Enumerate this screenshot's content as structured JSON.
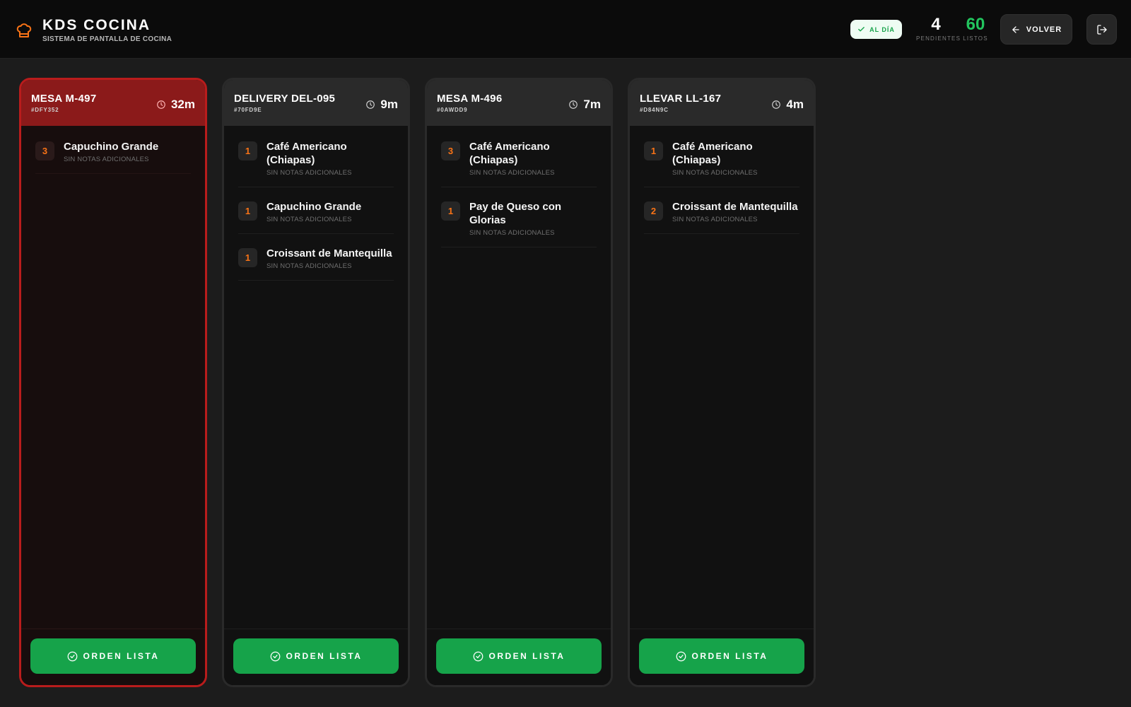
{
  "header": {
    "title": "KDS COCINA",
    "subtitle": "SISTEMA DE PANTALLA DE COCINA",
    "status_label": "AL DÍA",
    "pending_count": "4",
    "pending_label": "PENDIENTES",
    "ready_count": "60",
    "ready_label": "LISTOS",
    "back_label": "VOLVER"
  },
  "colors": {
    "accent_orange": "#f97316",
    "success_green": "#16a34a",
    "late_red": "#8b1a1a"
  },
  "orders": [
    {
      "title": "MESA M-497",
      "code": "#DFY352",
      "elapsed": "32m",
      "late": true,
      "items": [
        {
          "qty": "3",
          "name": "Capuchino Grande",
          "notes": "SIN NOTAS ADICIONALES"
        }
      ],
      "action_label": "ORDEN LISTA"
    },
    {
      "title": "DELIVERY DEL-095",
      "code": "#70FD9E",
      "elapsed": "9m",
      "late": false,
      "items": [
        {
          "qty": "1",
          "name": "Café Americano (Chiapas)",
          "notes": "SIN NOTAS ADICIONALES"
        },
        {
          "qty": "1",
          "name": "Capuchino Grande",
          "notes": "SIN NOTAS ADICIONALES"
        },
        {
          "qty": "1",
          "name": "Croissant de Mantequilla",
          "notes": "SIN NOTAS ADICIONALES"
        }
      ],
      "action_label": "ORDEN LISTA"
    },
    {
      "title": "MESA M-496",
      "code": "#0AWDD9",
      "elapsed": "7m",
      "late": false,
      "items": [
        {
          "qty": "3",
          "name": "Café Americano (Chiapas)",
          "notes": "SIN NOTAS ADICIONALES"
        },
        {
          "qty": "1",
          "name": "Pay de Queso con Glorias",
          "notes": "SIN NOTAS ADICIONALES"
        }
      ],
      "action_label": "ORDEN LISTA"
    },
    {
      "title": "LLEVAR LL-167",
      "code": "#D84N9C",
      "elapsed": "4m",
      "late": false,
      "items": [
        {
          "qty": "1",
          "name": "Café Americano (Chiapas)",
          "notes": "SIN NOTAS ADICIONALES"
        },
        {
          "qty": "2",
          "name": "Croissant de Mantequilla",
          "notes": "SIN NOTAS ADICIONALES"
        }
      ],
      "action_label": "ORDEN LISTA"
    }
  ]
}
